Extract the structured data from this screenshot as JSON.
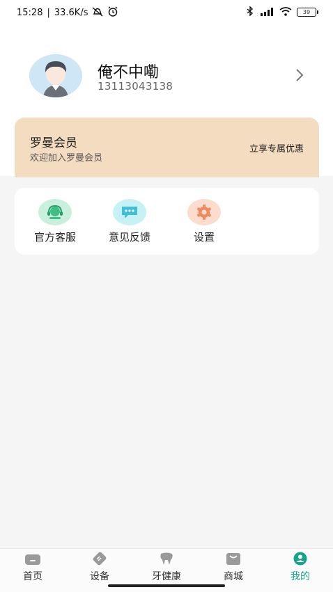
{
  "status_bar": {
    "time": "15:28",
    "separator": "|",
    "speed": "33.6K/s",
    "battery": "39",
    "icons": [
      "mute-icon",
      "alarm-icon",
      "bluetooth-icon",
      "signal-icon",
      "wifi-icon",
      "battery-icon"
    ]
  },
  "profile": {
    "name": "俺不中嘞",
    "phone": "13113043138",
    "avatar_icon": "avatar-icon",
    "chevron_icon": "chevron-right-icon"
  },
  "member": {
    "title": "罗曼会员",
    "subtitle": "欢迎加入罗曼会员",
    "offer": "立享专属优惠"
  },
  "services": [
    {
      "label": "官方客服",
      "icon": "customer-service-icon",
      "color": "#6dd3a5"
    },
    {
      "label": "意见反馈",
      "icon": "feedback-icon",
      "color": "#5fd0e0"
    },
    {
      "label": "设置",
      "icon": "settings-gear-icon",
      "color": "#f09a76"
    }
  ],
  "bottom_nav": [
    {
      "label": "首页",
      "icon": "home-icon"
    },
    {
      "label": "设备",
      "icon": "device-icon"
    },
    {
      "label": "牙健康",
      "icon": "tooth-icon"
    },
    {
      "label": "商城",
      "icon": "shop-bag-icon"
    },
    {
      "label": "我的",
      "icon": "profile-icon",
      "active": true
    }
  ],
  "colors": {
    "accent": "#14a38b",
    "member_card": "#f3dcc0",
    "background": "#f5f5f5"
  }
}
